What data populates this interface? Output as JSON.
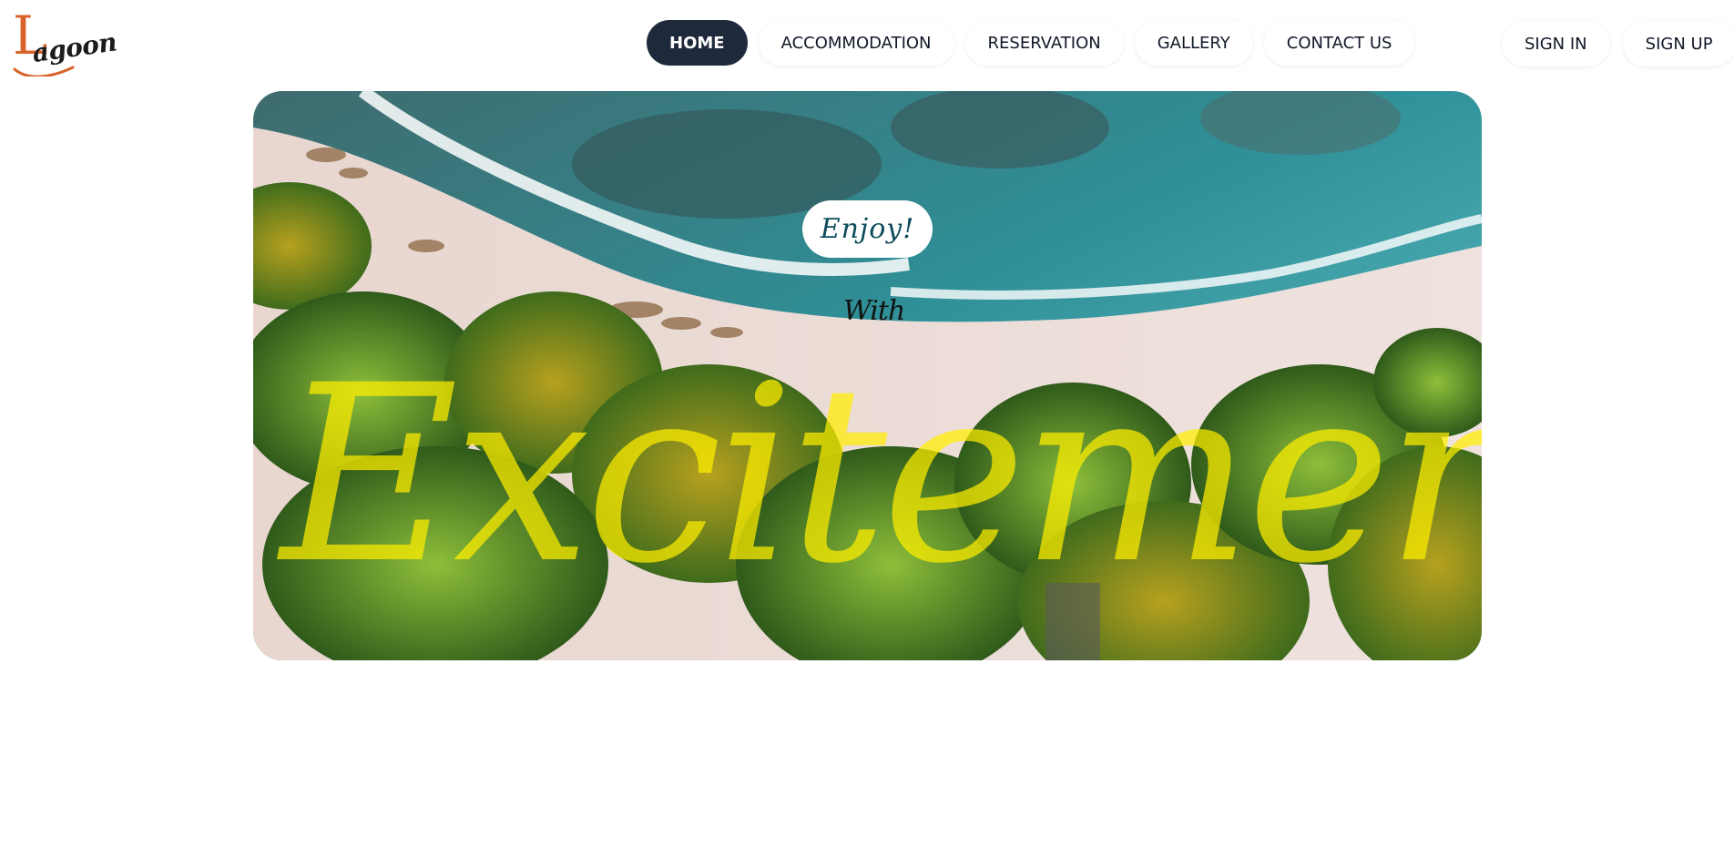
{
  "logo": {
    "initial": "L",
    "rest": "agoon",
    "initial_color": "#d9622b",
    "text_color": "#1b1b1b"
  },
  "nav": {
    "items": [
      {
        "label": "HOME",
        "active": true
      },
      {
        "label": "ACCOMMODATION",
        "active": false
      },
      {
        "label": "RESERVATION",
        "active": false
      },
      {
        "label": "GALLERY",
        "active": false
      },
      {
        "label": "CONTACT US",
        "active": false
      }
    ],
    "active_color": "#1e293b"
  },
  "auth": {
    "sign_in": "SIGN IN",
    "sign_up": "SIGN UP"
  },
  "hero": {
    "badge": "Enjoy!",
    "subtitle": "With",
    "headline": "Excitement",
    "headline_color": "#ffee00",
    "image": "aerial-beach-palm-trees"
  }
}
